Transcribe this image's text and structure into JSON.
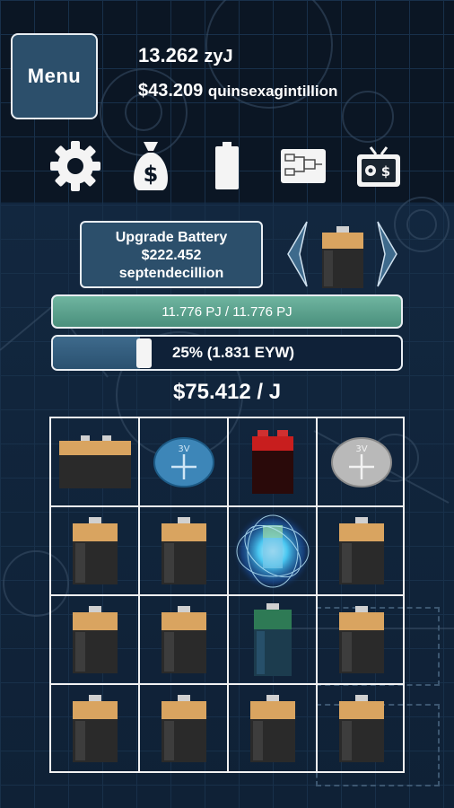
{
  "hud": {
    "menu_label": "Menu",
    "energy_value": "13.262",
    "energy_unit": "zyJ",
    "money_value": "$43.209",
    "money_unit": "quinsexagintillion"
  },
  "toolbar": {
    "icons": [
      "gear-icon",
      "money-bag-icon",
      "battery-icon",
      "blueprint-icon",
      "exchange-icon"
    ]
  },
  "upgrade": {
    "line1": "Upgrade Battery",
    "line2": "$222.452",
    "line3": "septendecillion"
  },
  "bars": {
    "energy_label": "11.776 PJ / 11.776 PJ",
    "energy_fill": 1.0,
    "power_label": "25% (1.831 EYW)",
    "power_level": 0.25
  },
  "rate_label": "$75.412 / J",
  "colors": {
    "panel": "#2c4f6b",
    "energy_bar": "#5fa28f",
    "battery_top": "#d9a460",
    "battery_body": "#2a2a2a"
  },
  "battery_grid": {
    "rows": [
      [
        "wide-battery",
        "coin-cell-blue",
        "red-9v-battery",
        "coin-cell-silver"
      ],
      [
        "battery",
        "battery",
        "charging-battery",
        "battery"
      ],
      [
        "battery",
        "battery",
        "green-battery",
        "battery"
      ],
      [
        "battery",
        "battery",
        "battery",
        "battery"
      ]
    ],
    "coin_label": "3V"
  }
}
